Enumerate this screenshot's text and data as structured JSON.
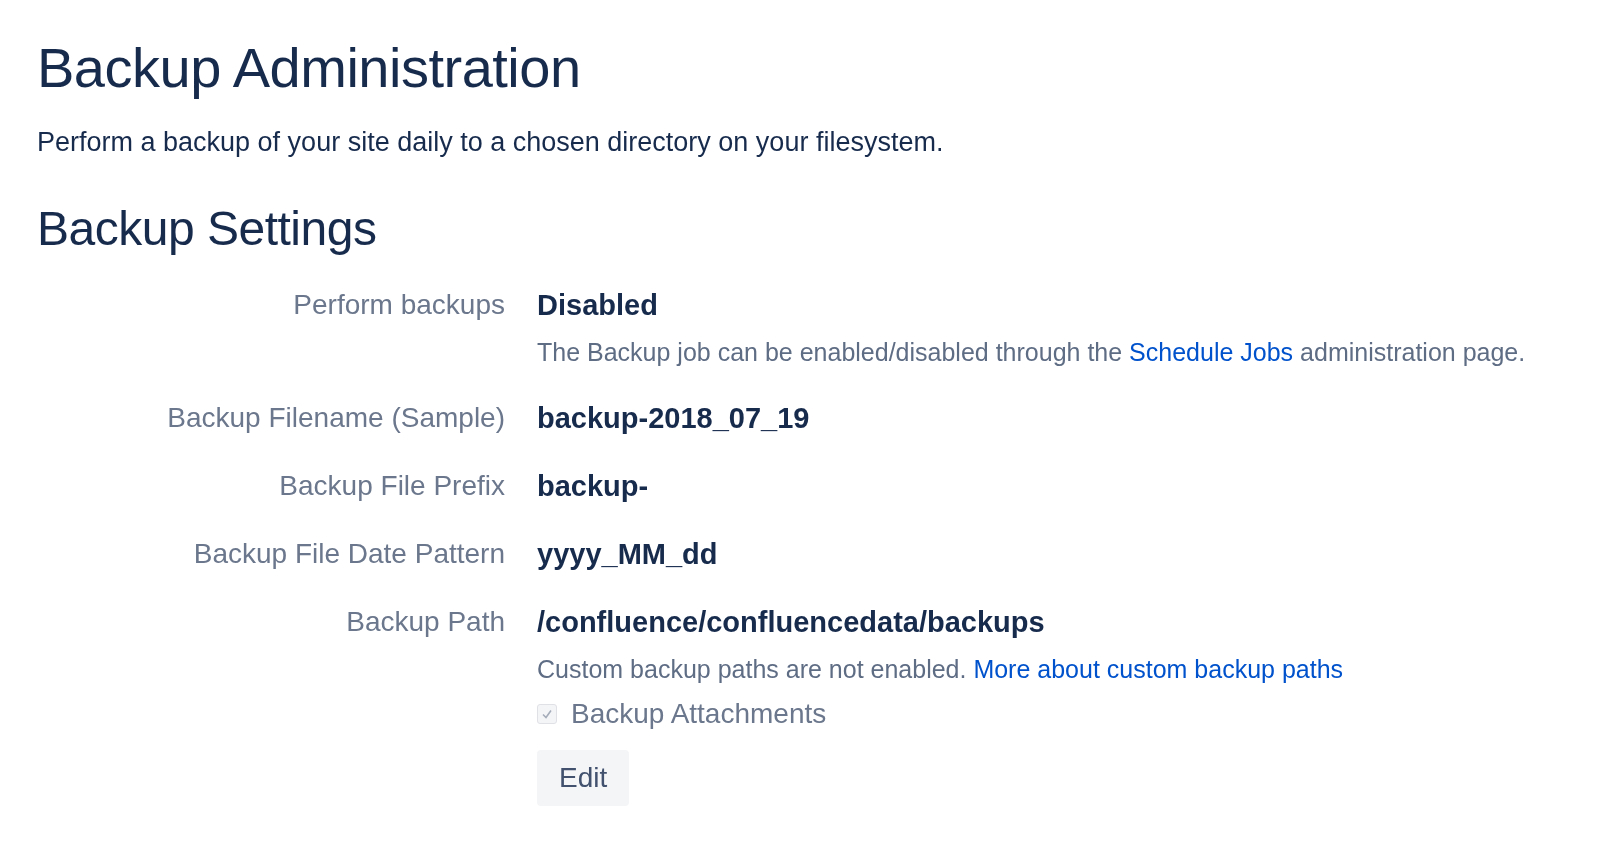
{
  "title": "Backup Administration",
  "description": "Perform a backup of your site daily to a chosen directory on your filesystem.",
  "section_title": "Backup Settings",
  "fields": [
    {
      "label": "Perform backups",
      "value": "Disabled",
      "help": {
        "before": "The Backup job can be enabled/disabled through the ",
        "link": "Schedule Jobs",
        "after": " administration page."
      }
    },
    {
      "label": "Backup Filename (Sample)",
      "value": "backup-2018_07_19"
    },
    {
      "label": "Backup File Prefix",
      "value": "backup-"
    },
    {
      "label": "Backup File Date Pattern",
      "value": "yyyy_MM_dd"
    },
    {
      "label": "Backup Path",
      "value": "/confluence/confluencedata/backups",
      "help": {
        "before": "Custom backup paths are not enabled. ",
        "link": "More about custom backup paths"
      }
    }
  ],
  "checkbox": {
    "label": "Backup Attachments",
    "checked": true,
    "disabled": true
  },
  "edit_button": "Edit"
}
